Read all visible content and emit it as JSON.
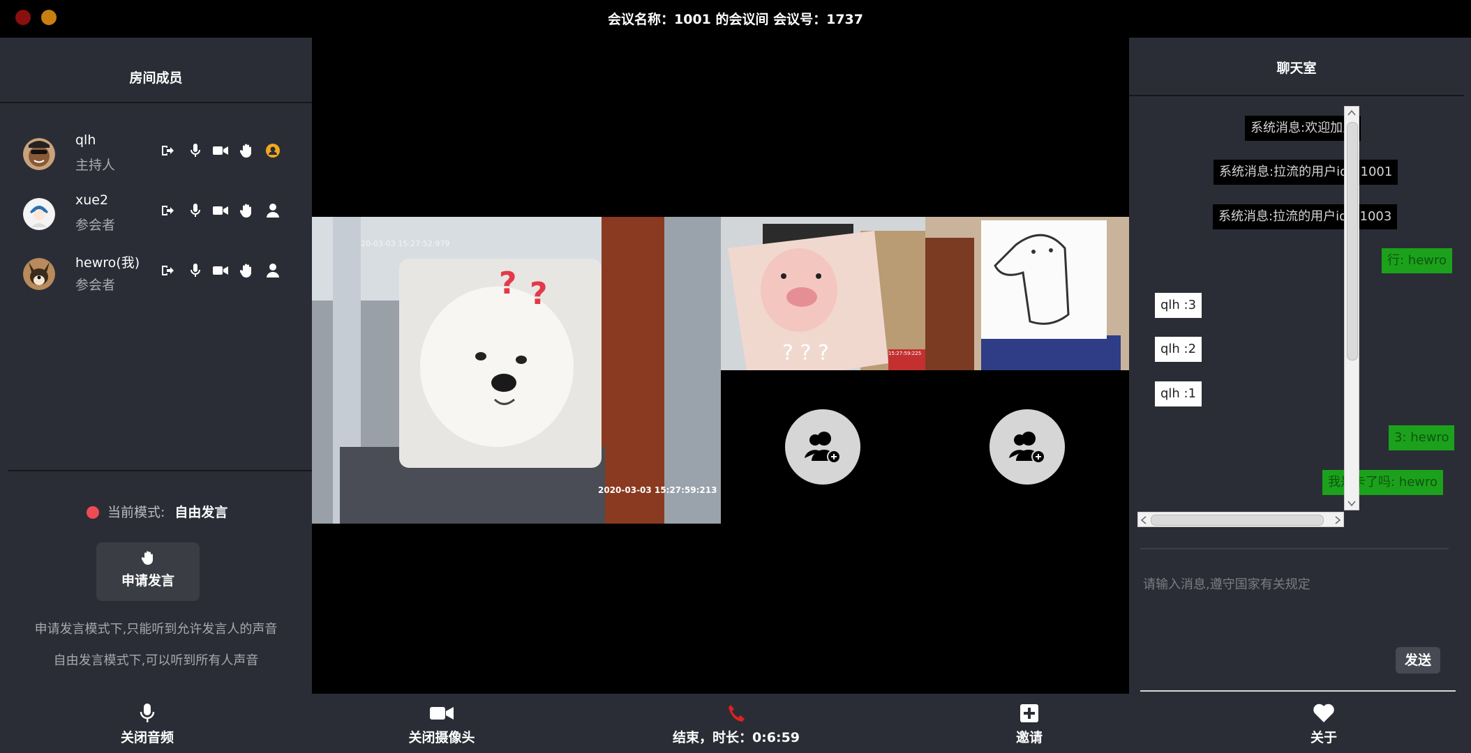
{
  "window": {
    "title": "会议名称：1001 的会议间 会议号：1737"
  },
  "members_panel": {
    "title": "房间成员",
    "members": [
      {
        "name": "qlh",
        "role": "主持人"
      },
      {
        "name": "xue2",
        "role": "参会者"
      },
      {
        "name": "hewro(我)",
        "role": "参会者"
      }
    ],
    "mode_label": "当前模式:",
    "mode_value": "自由发言",
    "apply_button": "申请发言",
    "hint_1": "申请发言模式下,只能听到允许发言人的声音",
    "hint_2": "自由发言模式下,可以听到所有人声音"
  },
  "video": {
    "timestamp_a": "20-03-03 15:27:52:979",
    "timestamp_b": "2020-03-03 15:27:59:213",
    "timestamp_c": "15:27:59:225"
  },
  "chat": {
    "title": "聊天室",
    "messages": [
      {
        "text": "系统消息:欢迎加入",
        "type": "system"
      },
      {
        "text": "系统消息:拉流的用户id：1001",
        "type": "system"
      },
      {
        "text": "系统消息:拉流的用户id：1003",
        "type": "system"
      },
      {
        "text": "行: hewro",
        "type": "mine"
      },
      {
        "text": "qlh :3",
        "type": "other"
      },
      {
        "text": "qlh :2",
        "type": "other"
      },
      {
        "text": "qlh :1",
        "type": "other"
      },
      {
        "text": "3: hewro",
        "type": "mine"
      },
      {
        "text": "我是卡了吗: hewro",
        "type": "mine"
      }
    ],
    "input_placeholder": "请输入消息,遵守国家有关规定",
    "send_button": "发送"
  },
  "toolbar": {
    "mute_audio": "关闭音频",
    "close_camera": "关闭摄像头",
    "end_call": "结束，时长：0:6:59",
    "invite": "邀请",
    "about": "关于"
  },
  "colors": {
    "panel_bg": "#2a2d35",
    "mode_dot": "#ef4b55",
    "host_badge": "#f0a81c",
    "end_call_red": "#e02020",
    "mine_bubble": "#1ca11c"
  }
}
